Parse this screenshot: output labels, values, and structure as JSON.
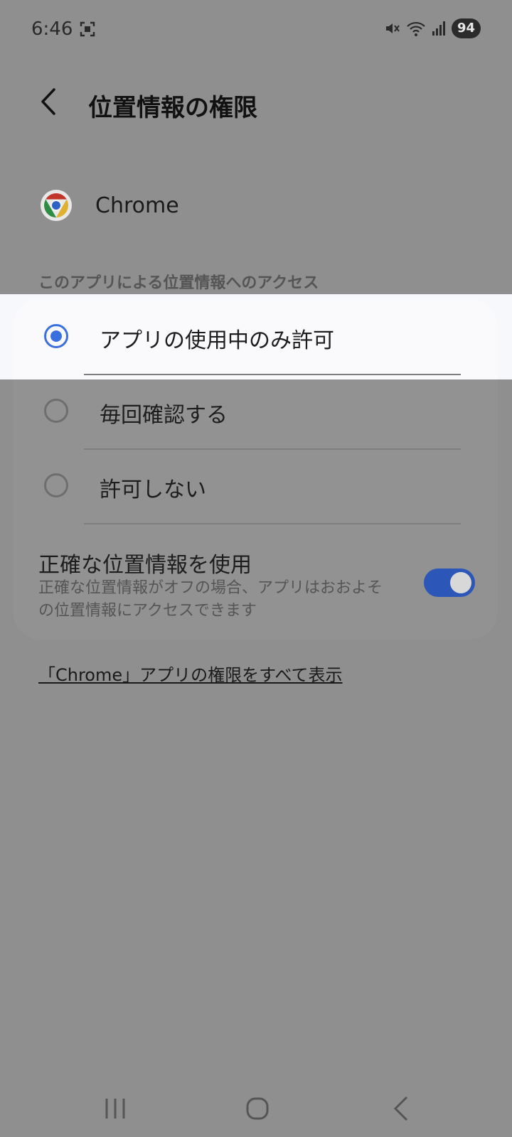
{
  "status_bar": {
    "time": "6:46",
    "battery": "94",
    "icons": [
      "screenshot-icon",
      "mute-icon",
      "wifi-icon",
      "signal-icon"
    ]
  },
  "header": {
    "title": "位置情報の権限",
    "back_icon": "chevron-left-icon"
  },
  "app": {
    "name": "Chrome",
    "icon": "chrome-icon"
  },
  "section_label": "このアプリによる位置情報へのアクセス",
  "options": [
    {
      "label": "アプリの使用中のみ許可",
      "selected": true
    },
    {
      "label": "毎回確認する",
      "selected": false
    },
    {
      "label": "許可しない",
      "selected": false
    }
  ],
  "precise": {
    "title": "正確な位置情報を使用",
    "description": "正確な位置情報がオフの場合、アプリはおおよその位置情報にアクセスできます",
    "enabled": true
  },
  "all_permissions_link": "「Chrome」アプリの権限をすべて表示",
  "nav": {
    "recents_icon": "recents-icon",
    "home_icon": "home-icon",
    "back_icon": "back-icon"
  },
  "colors": {
    "accent": "#3a6fe0",
    "toggle_on": "#2c56b8",
    "background": "#8f8f8f"
  }
}
